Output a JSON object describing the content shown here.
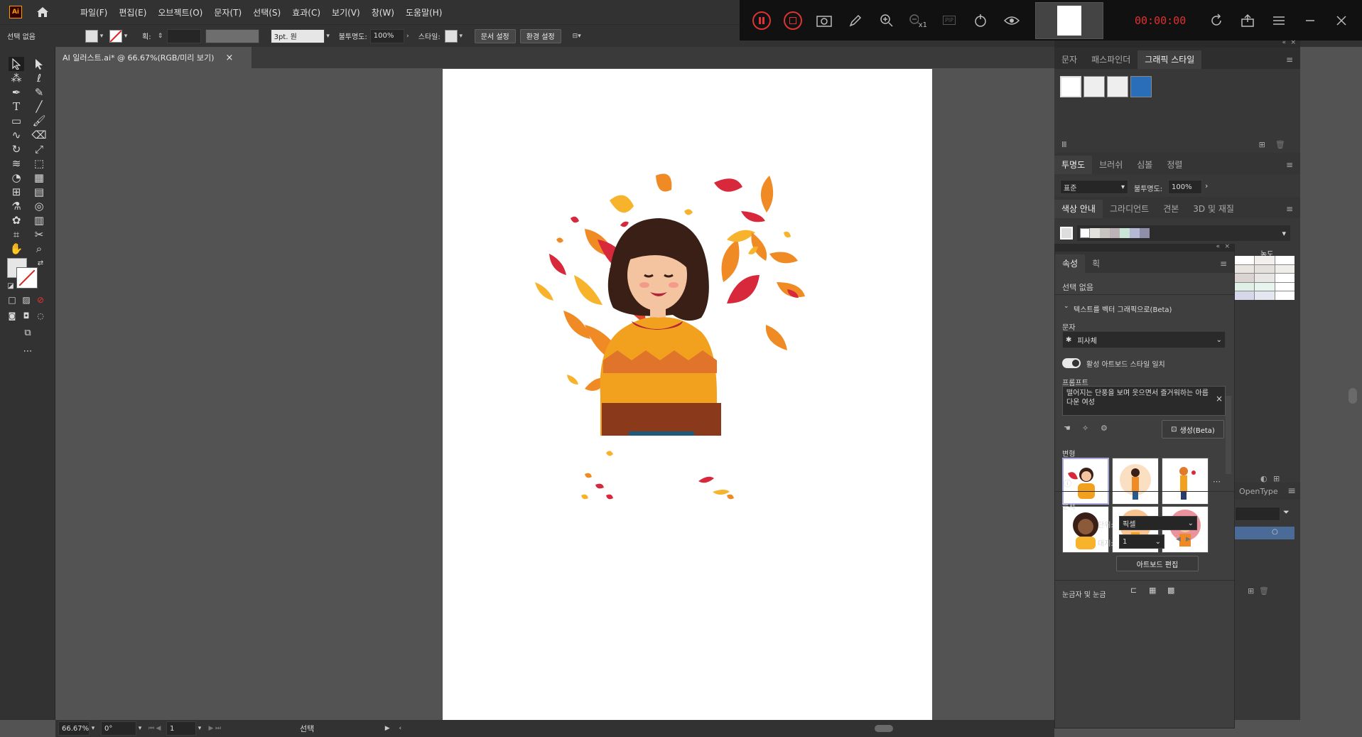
{
  "app_logo": "Ai",
  "menu": [
    "파일(F)",
    "편집(E)",
    "오브젝트(O)",
    "문자(T)",
    "선택(S)",
    "효과(C)",
    "보기(V)",
    "창(W)",
    "도움말(H)"
  ],
  "recorder": {
    "timer": "00:00:00",
    "zoom_label": "x1",
    "pip_label": "PIP"
  },
  "control_bar": {
    "selection_label": "선택 없음",
    "stroke_label": "획:",
    "brush_value": "3pt. 원",
    "opacity_label": "불투명도:",
    "opacity_value": "100%",
    "style_label": "스타일:",
    "doc_setup_btn": "문서 설정",
    "prefs_btn": "환경 설정"
  },
  "doc_tab": {
    "title": "AI 일러스트.ai* @ 66.67%(RGB/미리 보기)",
    "close": "×"
  },
  "status_bar": {
    "zoom": "66.67%",
    "rotation": "0°",
    "artboard_num": "1",
    "tool_name": "선택"
  },
  "panels": {
    "graphic_styles_tabs": [
      "문자",
      "패스파인더",
      "그래픽 스타일"
    ],
    "transparency_tabs": [
      "투명도",
      "브러쉬",
      "심볼",
      "정렬"
    ],
    "blend_mode": "표준",
    "transparency_opacity_label": "불투명도:",
    "transparency_opacity_value": "100%",
    "color_guide_tabs": [
      "색상 안내",
      "그라디언트",
      "견본",
      "3D 및 재질"
    ],
    "density_label": "농도",
    "opentype_label": "OpenType",
    "color_guide_swatches": [
      "#e3e1dc",
      "#c8c4c0",
      "#bdb2b8",
      "#c9e6d8",
      "#b4b8d4",
      "#8f8ea8"
    ]
  },
  "properties": {
    "tabs": [
      "속성",
      "획"
    ],
    "selection": "선택 없음",
    "section_text_to_vector": "텍스트를 벡터 그래픽으로(Beta)",
    "label_subject": "문자",
    "subject_value": "피사체",
    "toggle_label": "활성 아트보드 스타일 일치",
    "prompt_label": "프롬프트",
    "prompt_text": "떨어지는 단풍을 보며 웃으면서 즐거워하는 아름다운 여성",
    "generate_btn": "생성(Beta)",
    "variations_label": "변형",
    "document_label": "문서",
    "units_label": "단위:",
    "units_value": "픽셀",
    "artboard_label": "대지:",
    "artboard_value": "1",
    "edit_artboards_btn": "아트보드 편집",
    "rulers_label": "눈금자 및 눈금"
  },
  "colors": {
    "accent_leaf_orange": "#f08a24",
    "accent_leaf_red": "#d8283c",
    "accent_leaf_yellow": "#f7b32b",
    "sweater": "#f2a11e",
    "skin": "#f4c4a0",
    "hair": "#3a1f17"
  }
}
